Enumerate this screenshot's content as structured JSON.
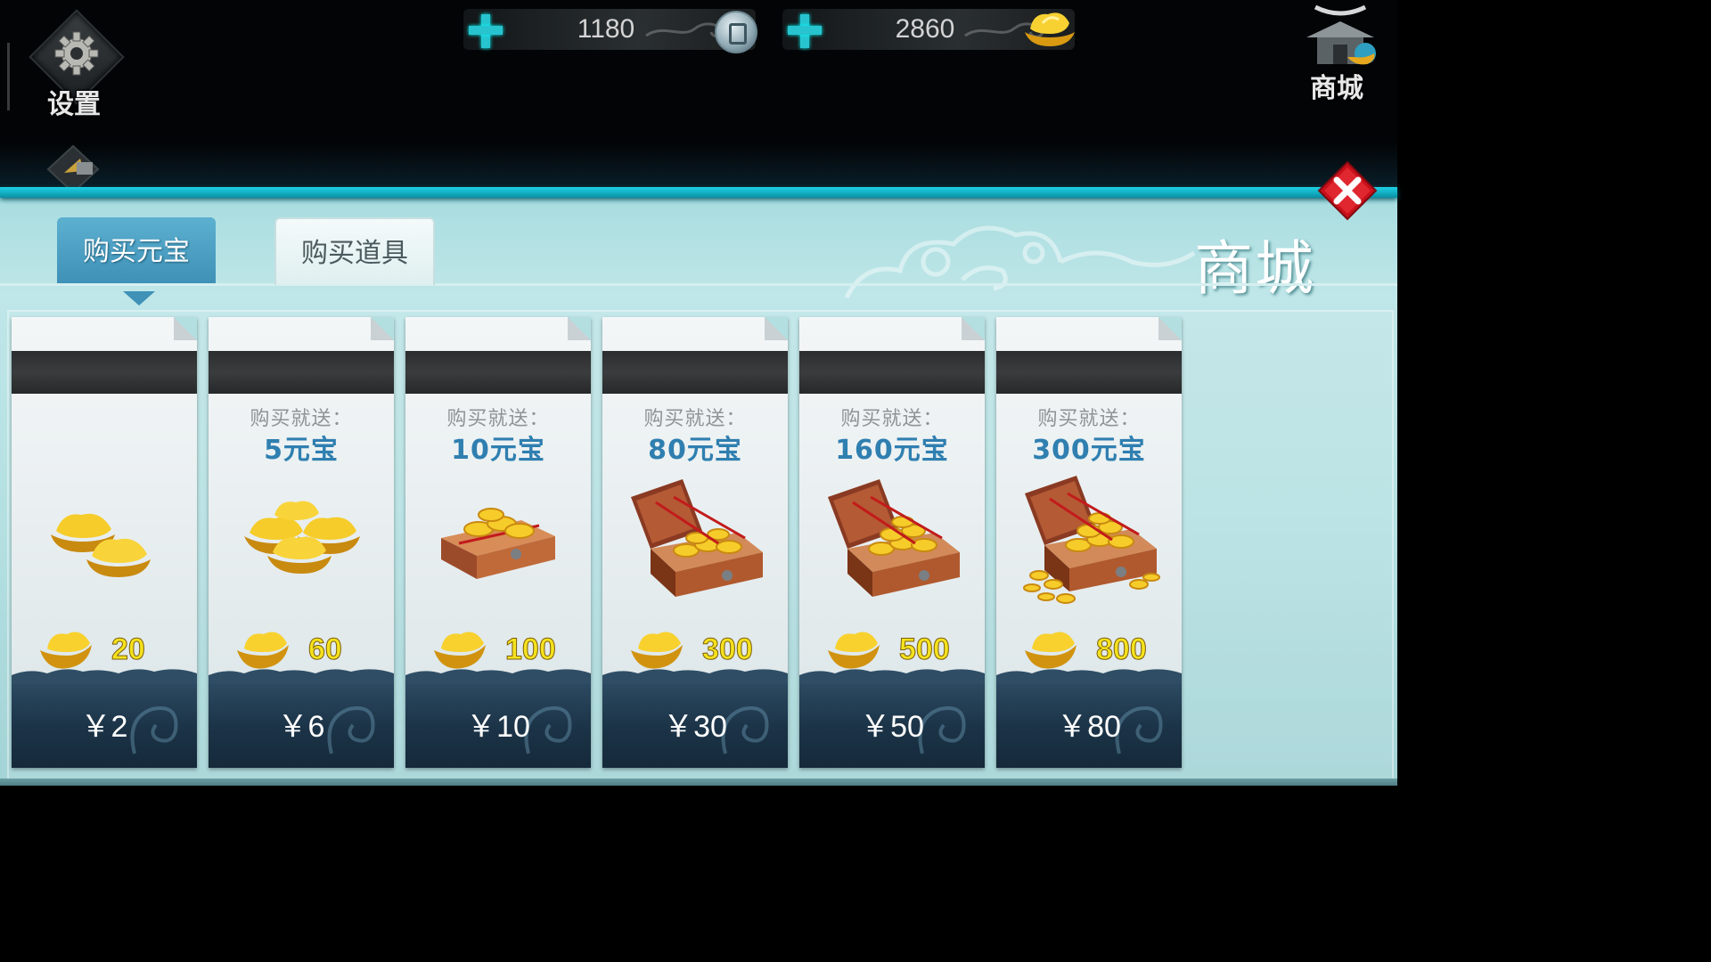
{
  "hud": {
    "settings_label": "设置",
    "currency_copper": {
      "value": "1180",
      "icon": "copper-coin-icon"
    },
    "currency_ingot": {
      "value": "2860",
      "icon": "gold-ingot-icon"
    },
    "shop_label": "商城",
    "accent_color": "#27c4cf"
  },
  "panel": {
    "title": "商城",
    "tabs": [
      {
        "label": "购买元宝",
        "active": true
      },
      {
        "label": "购买道具",
        "active": false
      }
    ],
    "close_icon": "close-icon"
  },
  "products": [
    {
      "promo_title": "",
      "promo_value": "",
      "gold": "20",
      "price": "￥2",
      "art": "two-ingots"
    },
    {
      "promo_title": "购买就送：",
      "promo_value": "5元宝",
      "gold": "60",
      "price": "￥6",
      "art": "ingot-pile"
    },
    {
      "promo_title": "购买就送：",
      "promo_value": "10元宝",
      "gold": "100",
      "price": "￥10",
      "art": "small-box"
    },
    {
      "promo_title": "购买就送：",
      "promo_value": "80元宝",
      "gold": "300",
      "price": "￥30",
      "art": "open-chest"
    },
    {
      "promo_title": "购买就送：",
      "promo_value": "160元宝",
      "gold": "500",
      "price": "￥50",
      "art": "open-chest"
    },
    {
      "promo_title": "购买就送：",
      "promo_value": "300元宝",
      "gold": "800",
      "price": "￥80",
      "art": "overflowing-chest"
    }
  ]
}
